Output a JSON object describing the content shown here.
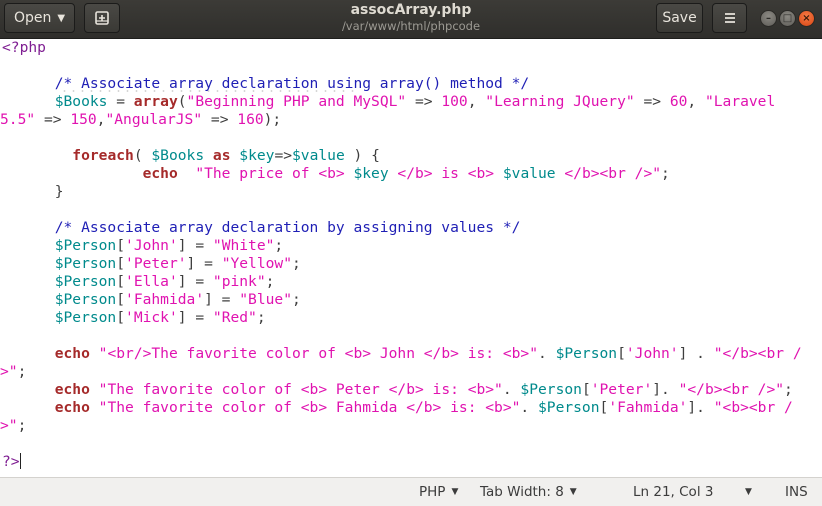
{
  "header": {
    "open_label": "Open",
    "title": "assocArray.php",
    "subtitle": "/var/www/html/phpcode",
    "save_label": "Save",
    "new_doc_icon": "new-tab-icon",
    "menu_icon": "hamburger-menu-icon"
  },
  "window_controls": {
    "minimize": "–",
    "maximize": "□",
    "close": "×"
  },
  "code": {
    "l1": "<?php",
    "l3_comment": "/* Associate array declaration using array() method */",
    "l4_var": "$Books",
    "l4_eq": " = ",
    "l4_fn": "array",
    "l4_paren": "(",
    "l4_s1": "\"Beginning PHP and MySQL\"",
    "l4_arr1": " => ",
    "l4_n1": "100",
    "l4_sep1": ", ",
    "l4_s2": "\"Learning JQuery\"",
    "l4_arr2": " => ",
    "l4_n2": "60",
    "l4_sep2": ", ",
    "l4_s3a": "\"Laravel",
    "l5_s3b": "5.5\"",
    "l5_arr3": " => ",
    "l5_n3": "150",
    "l5_sep3": ",",
    "l5_s4": "\"AngularJS\"",
    "l5_arr4": " => ",
    "l5_n4": "160",
    "l5_end": ");",
    "l7_kw": "foreach",
    "l7_p1": "( ",
    "l7_v1": "$Books",
    "l7_as": "as",
    "l7_v2": "$key",
    "l7_arrow": "=>",
    "l7_v3": "$value",
    "l7_p2": " ) {",
    "l8_kw": "echo",
    "l8_s1": "\"The price of <b> ",
    "l8_v1": "$key",
    "l8_s2": " </b> is <b> ",
    "l8_v2": "$value",
    "l8_s3": " </b><br />\"",
    "l8_end": ";",
    "l9": "}",
    "l11_comment": "/* Associate array declaration by assigning values */",
    "assign": [
      {
        "var": "$Person",
        "key": "'John'",
        "val": "\"White\""
      },
      {
        "var": "$Person",
        "key": "'Peter'",
        "val": "\"Yellow\""
      },
      {
        "var": "$Person",
        "key": "'Ella'",
        "val": "\"pink\""
      },
      {
        "var": "$Person",
        "key": "'Fahmida'",
        "val": "\"Blue\""
      },
      {
        "var": "$Person",
        "key": "'Mick'",
        "val": "\"Red\""
      }
    ],
    "e1_kw": "echo",
    "e1_s1": "\"<br/>The favorite color of <b> John </b> is: <b>\"",
    "e1_d1": ". ",
    "e1_var": "$Person",
    "e1_key": "'John'",
    "e1_d2": " . ",
    "e1_s2": "\"</b><br /",
    "e1_cont": ">\"",
    "e1_end": ";",
    "e2_kw": "echo",
    "e2_s1": "\"The favorite color of <b> Peter </b> is: <b>\"",
    "e2_d1": ". ",
    "e2_var": "$Person",
    "e2_key": "'Peter'",
    "e2_d2": "]. ",
    "e2_s2": "\"</b><br />\"",
    "e2_end": ";",
    "e3_kw": "echo",
    "e3_s1": "\"The favorite color of <b> Fahmida </b> is: <b>\"",
    "e3_d1": ". ",
    "e3_var": "$Person",
    "e3_key": "'Fahmida'",
    "e3_d2": "]. ",
    "e3_s2": "\"<b><br /",
    "e3_cont": ">\"",
    "e3_end": ";",
    "close_tag": "?>"
  },
  "status": {
    "language": "PHP",
    "tab_width": "Tab Width: 8",
    "position": "Ln 21, Col 3",
    "mode": "INS"
  },
  "colors": {
    "keyword": "#a52a2a",
    "variable": "#008a8c",
    "string": "#e013b0",
    "comment": "#1f1fb5",
    "preprocessor": "#7f1e92"
  }
}
